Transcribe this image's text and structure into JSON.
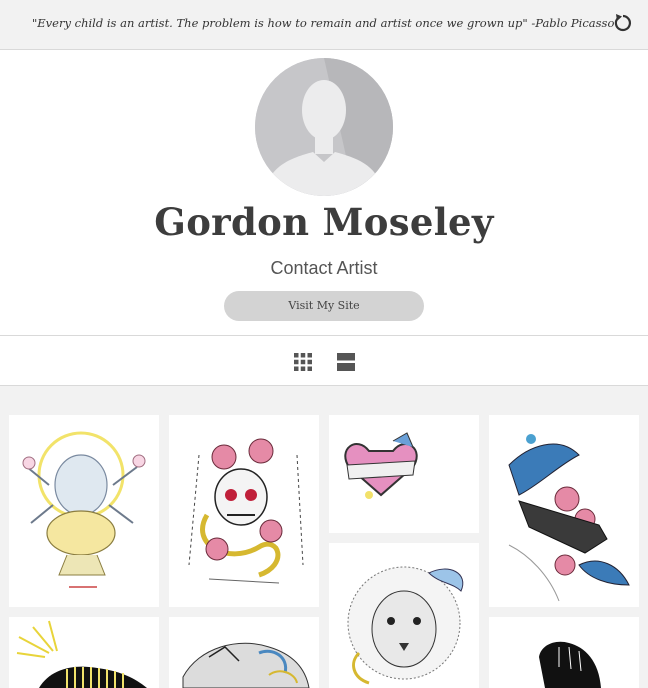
{
  "header": {
    "quote": "\"Every child is an artist. The problem is how to remain and artist once we grown up\" -Pablo Picasso",
    "refresh_icon": "refresh-icon"
  },
  "profile": {
    "name": "Gordon Moseley",
    "contact_label": "Contact Artist",
    "visit_label": "Visit My Site",
    "avatar_icon": "default-avatar"
  },
  "view_toggle": {
    "grid_icon": "grid-view-icon",
    "list_icon": "list-view-icon"
  },
  "gallery": {
    "items": [
      {
        "subject": "ganesha-drawing"
      },
      {
        "subject": "skull-roses-drawing"
      },
      {
        "subject": "heart-banner-drawing"
      },
      {
        "subject": "swallows-revolver-drawing"
      },
      {
        "subject": "sunburst-drawing"
      },
      {
        "subject": "feline-drawing"
      },
      {
        "subject": "lion-drawing"
      },
      {
        "subject": "hand-drawing"
      }
    ]
  },
  "colors": {
    "background": "#f2f2f2",
    "button": "#d3d3d3",
    "name_text": "#3d3d3d"
  }
}
